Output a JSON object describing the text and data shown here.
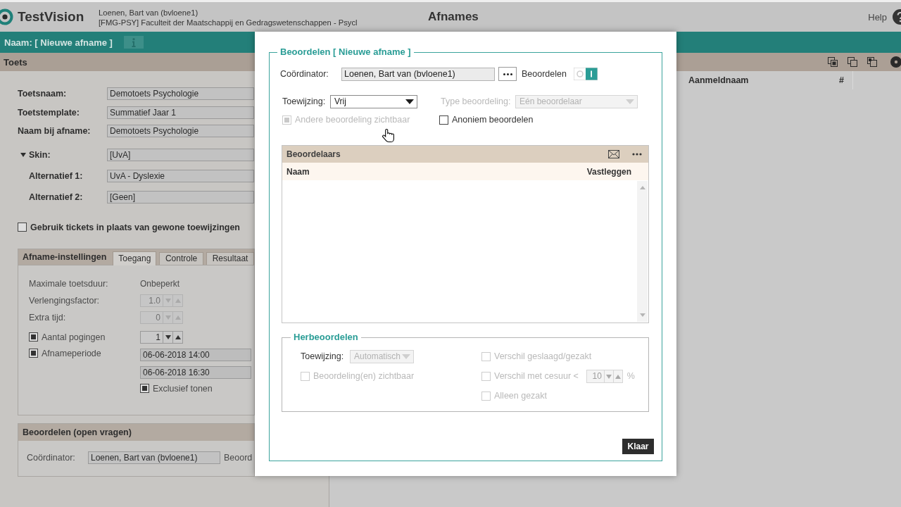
{
  "header": {
    "logo": "TestVision",
    "user": "Loenen, Bart van (bvloene1)",
    "organization": "[FMG-PSY] Faculteit der Maatschappij en Gedragswetenschappen - Psycl",
    "title": "Afnames",
    "help": "Help"
  },
  "name_bar": {
    "label": "Naam: [ Nieuwe afname ]"
  },
  "test_panel": {
    "title": "Toets",
    "fields": [
      {
        "label": "Toetsnaam:",
        "value": "Demotoets Psychologie"
      },
      {
        "label": "Toetstemplate:",
        "value": "Summatief Jaar 1"
      },
      {
        "label": "Naam bij afname:",
        "value": "Demotoets Psychologie"
      }
    ],
    "skin": {
      "label": "Skin:",
      "expanded": true,
      "value": "[UvA]",
      "alternatives": [
        {
          "label": "Alternatief 1:",
          "value": "UvA - Dyslexie"
        },
        {
          "label": "Alternatief 2:",
          "value": "[Geen]"
        }
      ]
    },
    "tickets": {
      "label": "Gebruik tickets in plaats van gewone toewijzingen",
      "checked": false
    },
    "settings": {
      "title": "Afname-instellingen",
      "tabs": [
        {
          "label": "Toegang",
          "selected": true
        },
        {
          "label": "Controle",
          "selected": false
        },
        {
          "label": "Resultaat",
          "selected": false
        }
      ],
      "rows": [
        {
          "kind": "text",
          "label": "Maximale toetsduur:",
          "value": "Onbeperkt"
        },
        {
          "kind": "spinner",
          "label": "Verlengingsfactor:",
          "value": "1.0",
          "disabled": true
        },
        {
          "kind": "spinner",
          "label": "Extra tijd:",
          "value": "0",
          "disabled": true
        },
        {
          "kind": "check_spinner",
          "label": "Aantal pogingen",
          "checked": true,
          "value": "1",
          "disabled": false
        },
        {
          "kind": "check_dates",
          "label": "Afnameperiode",
          "checked": true,
          "values": [
            "06-06-2018 14:00",
            "06-06-2018 16:30"
          ],
          "option": {
            "label": "Exclusief tonen",
            "checked": true
          }
        }
      ]
    },
    "grading": {
      "title": "Beoordelen (open vragen)",
      "coordinator_label": "Coördinator:",
      "coordinator": "Loenen, Bart van (bvloene1)",
      "grading_label": "Beoord"
    }
  },
  "participants_panel": {
    "columns": [
      "Aanmeldnaam",
      "#"
    ]
  },
  "dialog": {
    "legend": "Beoordelen [ Nieuwe afname ]",
    "coordinator_label": "Coördinator:",
    "coordinator": "Loenen, Bart van (bvloene1)",
    "grading_label": "Beoordelen",
    "grading_on": true,
    "assignment": {
      "label": "Toewijzing:",
      "value": "Vrij",
      "disabled": false
    },
    "grading_type": {
      "label": "Type beoordeling:",
      "value": "Eén beoordelaar",
      "disabled": true
    },
    "options": [
      {
        "label": "Andere beoordeling zichtbaar",
        "checked": true,
        "disabled": true
      },
      {
        "label": "Anoniem beoordelen",
        "checked": false,
        "disabled": false
      }
    ],
    "graders": {
      "title": "Beoordelaars",
      "columns": [
        "Naam",
        "Vastleggen"
      ]
    },
    "regrading": {
      "legend": "Herbeoordelen",
      "assignment": {
        "label": "Toewijzing:",
        "value": "Automatisch",
        "disabled": true
      },
      "left_options": [
        {
          "kind": "check",
          "label": "Beoordeling(en) zichtbaar",
          "checked": false,
          "disabled": true
        }
      ],
      "right_options": [
        {
          "kind": "check",
          "label": "Verschil geslaagd/gezakt",
          "checked": false,
          "disabled": true
        },
        {
          "kind": "spinner",
          "label": "Verschil met cesuur <",
          "value": "10",
          "unit": "%",
          "checked": false,
          "disabled": true
        },
        {
          "kind": "check",
          "label": "Alleen gezakt",
          "checked": false,
          "disabled": true
        }
      ]
    },
    "done_button": "Klaar"
  }
}
